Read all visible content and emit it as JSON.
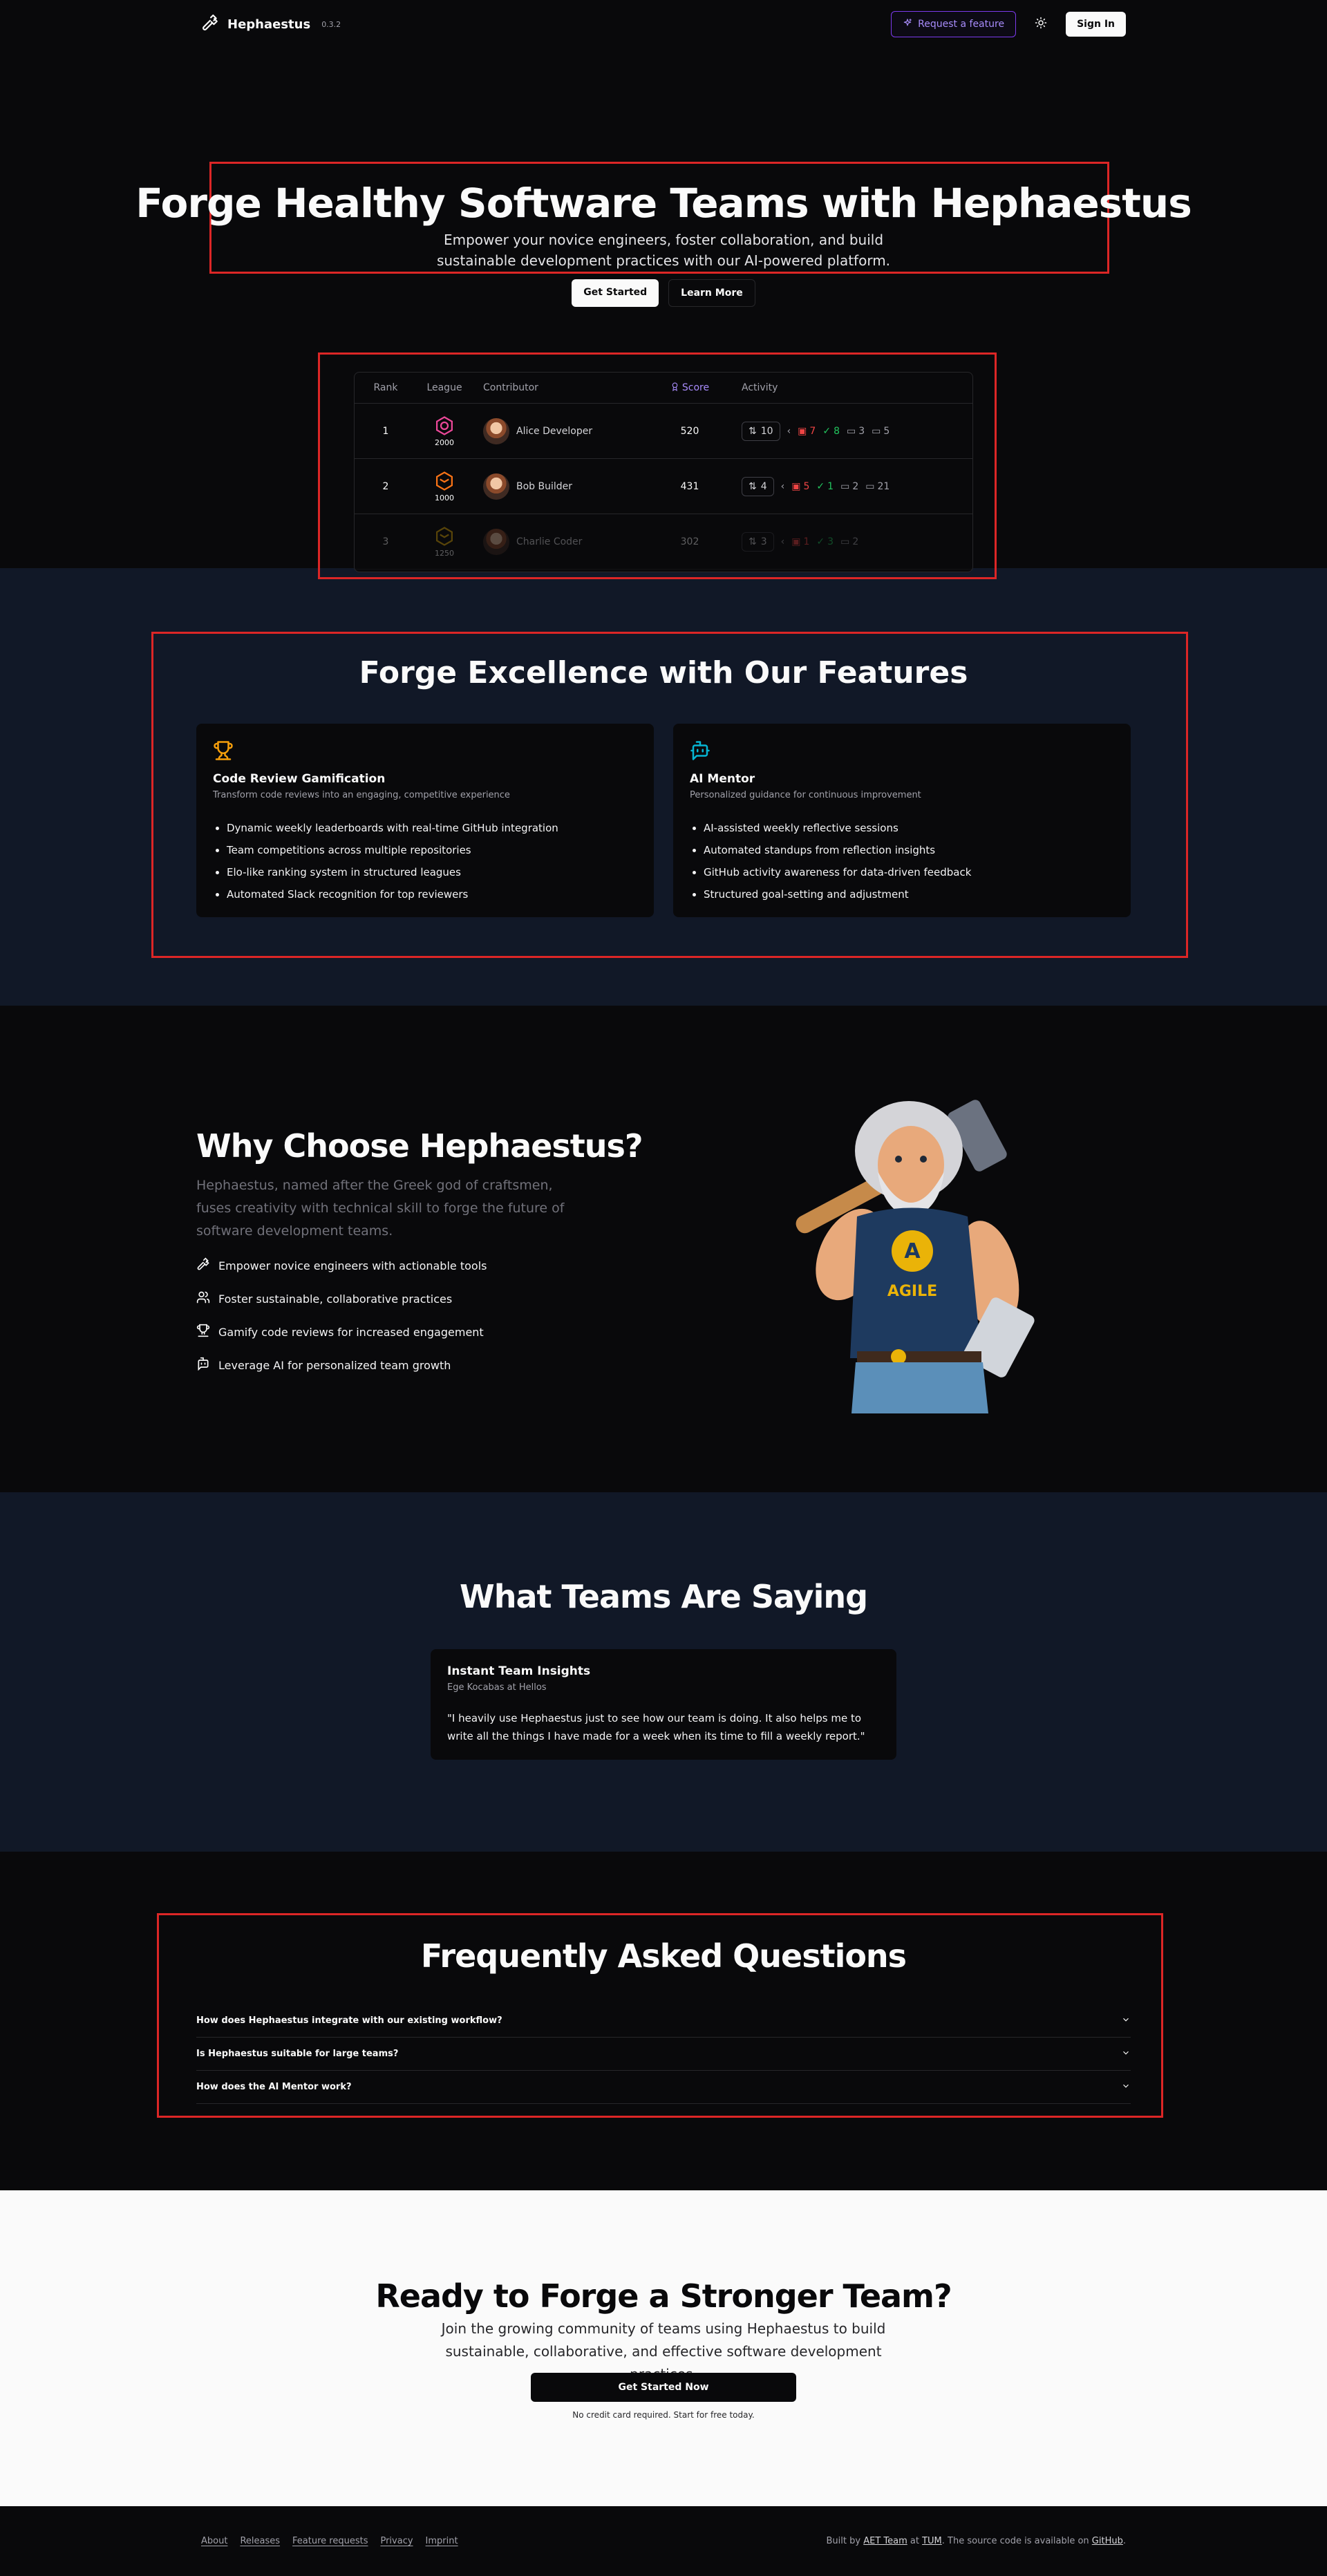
{
  "nav": {
    "brand": "Hephaestus",
    "version": "0.3.2",
    "request_feature": "Request a feature",
    "sign_in": "Sign In"
  },
  "hero": {
    "title": "Forge Healthy Software Teams with Hephaestus",
    "subtitle": "Empower your novice engineers, foster collaboration, and build sustainable development practices with our AI-powered platform.",
    "get_started": "Get Started",
    "learn_more": "Learn More"
  },
  "leaderboard": {
    "headers": {
      "rank": "Rank",
      "league": "League",
      "contributor": "Contributor",
      "score": "Score",
      "activity": "Activity"
    },
    "rows": [
      {
        "rank": "1",
        "league_points": "2000",
        "league_color": "#ec4899",
        "name": "Alice Developer",
        "score": "520",
        "prs": "10",
        "changes": "7",
        "approvals": "8",
        "comments": "3",
        "code_comments": "5"
      },
      {
        "rank": "2",
        "league_points": "1000",
        "league_color": "#f97316",
        "name": "Bob Builder",
        "score": "431",
        "prs": "4",
        "changes": "5",
        "approvals": "1",
        "comments": "2",
        "code_comments": "21"
      },
      {
        "rank": "3",
        "league_points": "1250",
        "league_color": "#eab308",
        "name": "Charlie Coder",
        "score": "302",
        "prs": "3",
        "changes": "1",
        "approvals": "3",
        "comments": "",
        "code_comments": "2"
      }
    ]
  },
  "features": {
    "title": "Forge Excellence with Our Features",
    "cards": [
      {
        "icon": "trophy-icon",
        "title": "Code Review Gamification",
        "subtitle": "Transform code reviews into an engaging, competitive experience",
        "items": [
          "Dynamic weekly leaderboards with real-time GitHub integration",
          "Team competitions across multiple repositories",
          "Elo-like ranking system in structured leagues",
          "Automated Slack recognition for top reviewers"
        ]
      },
      {
        "icon": "bot-message-icon",
        "title": "AI Mentor",
        "subtitle": "Personalized guidance for continuous improvement",
        "items": [
          "AI-assisted weekly reflective sessions",
          "Automated standups from reflection insights",
          "GitHub activity awareness for data-driven feedback",
          "Structured goal-setting and adjustment"
        ]
      }
    ]
  },
  "why": {
    "title": "Why Choose Hephaestus?",
    "description": "Hephaestus, named after the Greek god of craftsmen, fuses creativity with technical skill to forge the future of software development teams.",
    "items": [
      "Empower novice engineers with actionable tools",
      "Foster sustainable, collaborative practices",
      "Gamify code reviews for increased engagement",
      "Leverage AI for personalized team growth"
    ],
    "mascot_shirt_letter": "A",
    "mascot_shirt_text": "AGILE"
  },
  "testimonials": {
    "title": "What Teams Are Saying",
    "card": {
      "title": "Instant Team Insights",
      "author": "Ege Kocabas at Hellos",
      "quote": "\"I heavily use Hephaestus just to see how our team is doing. It also helps me to write all the things I have made for a week when its time to fill a weekly report.\""
    }
  },
  "faq": {
    "title": "Frequently Asked Questions",
    "items": [
      "How does Hephaestus integrate with our existing workflow?",
      "Is Hephaestus suitable for large teams?",
      "How does the AI Mentor work?"
    ]
  },
  "cta": {
    "title": "Ready to Forge a Stronger Team?",
    "subtitle": "Join the growing community of teams using Hephaestus to build sustainable, collaborative, and effective software development practices.",
    "button": "Get Started Now",
    "note": "No credit card required. Start for free today."
  },
  "footer": {
    "links": [
      "About",
      "Releases",
      "Feature requests",
      "Privacy",
      "Imprint"
    ],
    "built_by_prefix": "Built by ",
    "team": "AET Team",
    "at": " at ",
    "org": "TUM",
    "source_text": ". The source code is available on ",
    "github": "GitHub",
    "end": "."
  },
  "colors": {
    "accent_purple": "#a78bfa",
    "highlight_red": "#dc2626",
    "trophy_amber": "#f59e0b",
    "bot_cyan": "#06b6d4"
  }
}
